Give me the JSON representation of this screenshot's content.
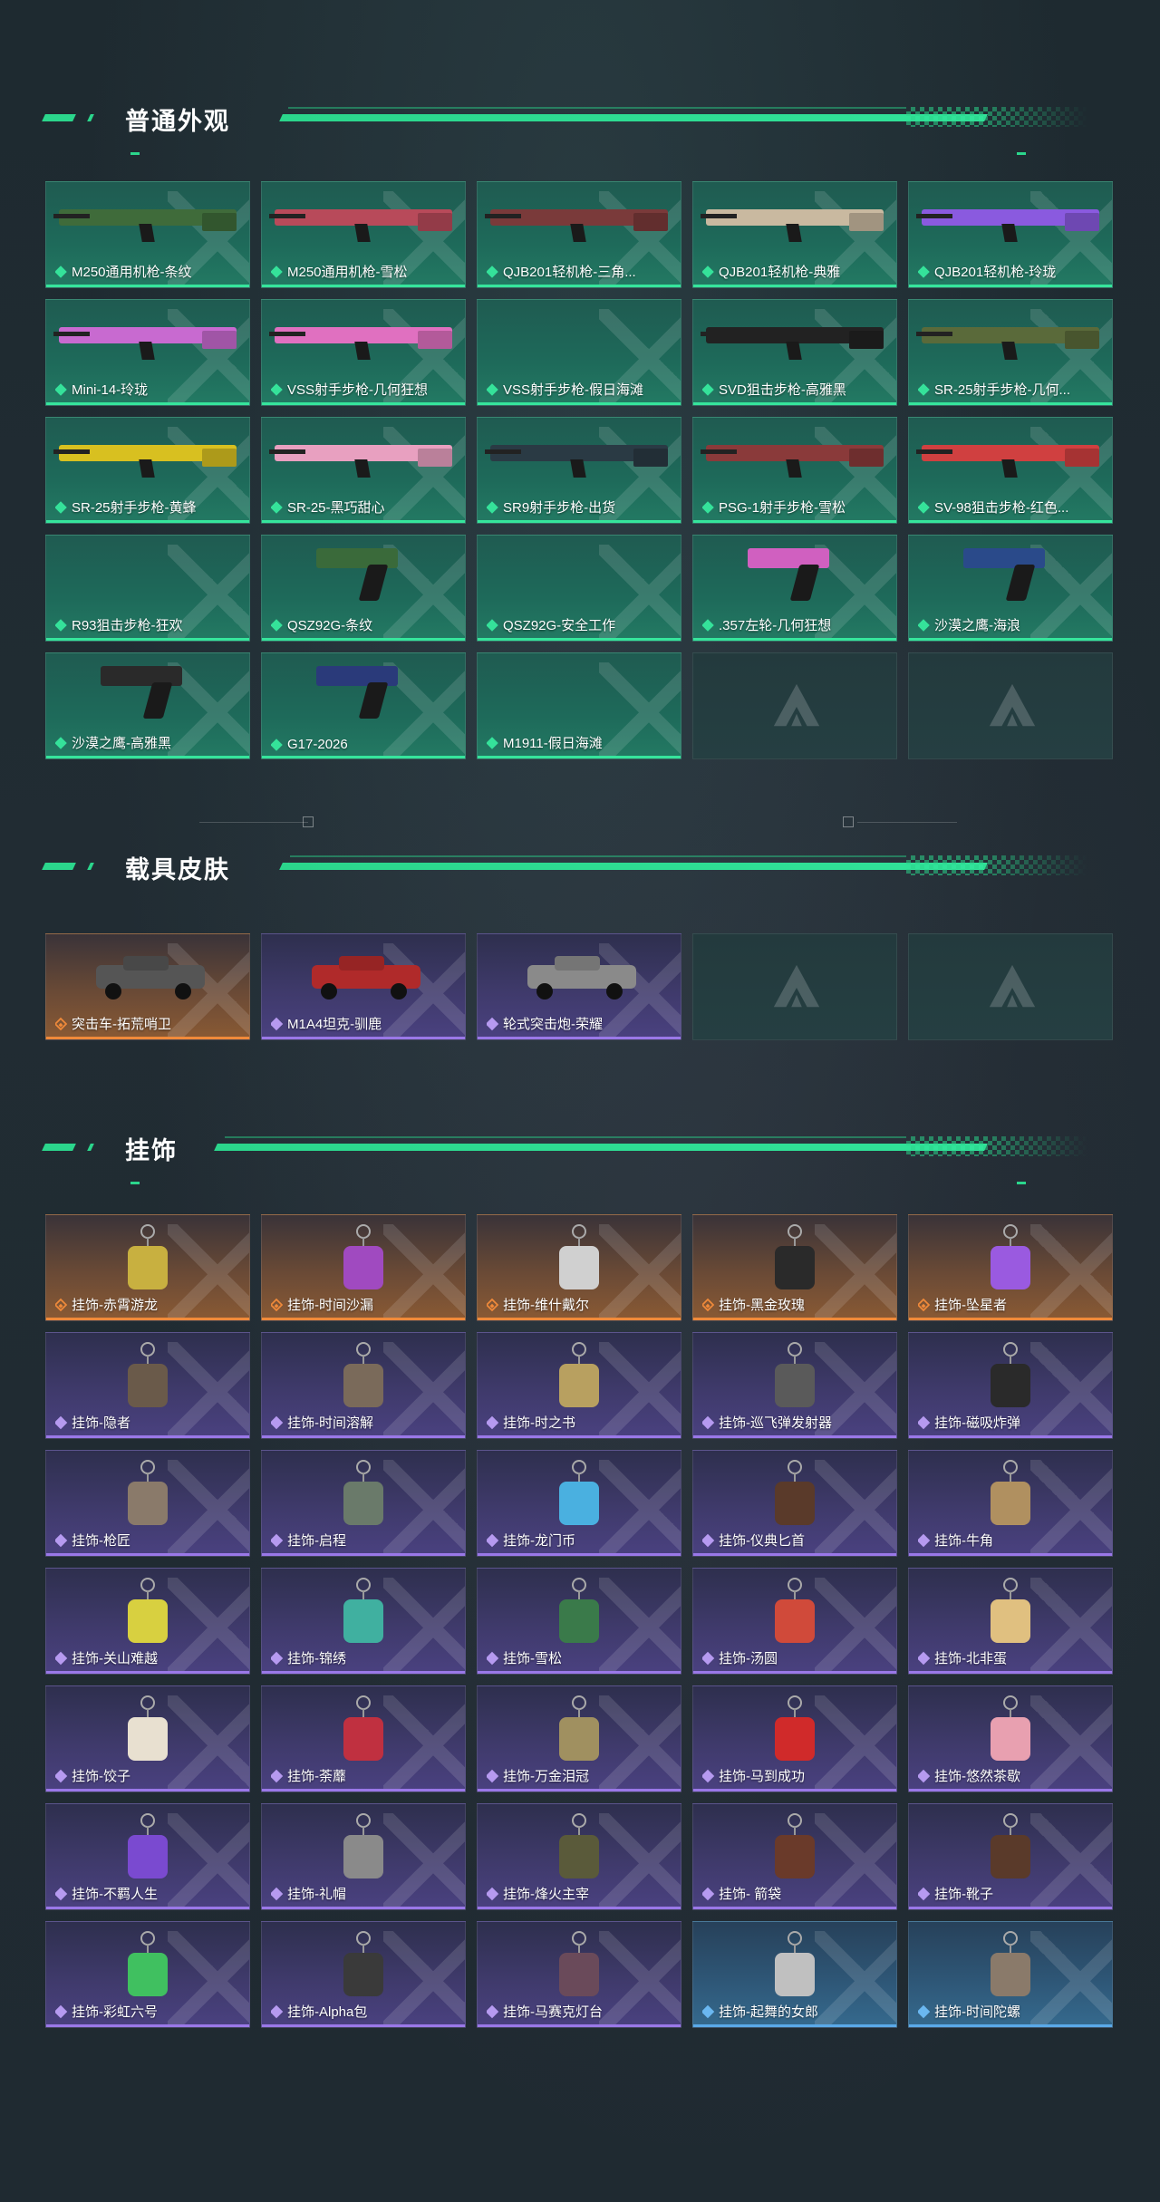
{
  "sections": {
    "weapons": {
      "title": "普通外观"
    },
    "vehicles": {
      "title": "载具皮肤"
    },
    "charms": {
      "title": "挂饰"
    }
  },
  "weapons": [
    {
      "label": "M250通用机枪-条纹",
      "rarity": "green",
      "color": "#3f6b3a"
    },
    {
      "label": "M250通用机枪-雪松",
      "rarity": "green",
      "color": "#b84a5a"
    },
    {
      "label": "QJB201轻机枪-三角...",
      "rarity": "green",
      "color": "#7a3a3a"
    },
    {
      "label": "QJB201轻机枪-典雅",
      "rarity": "green",
      "color": "#c9b9a0"
    },
    {
      "label": "QJB201轻机枪-玲珑",
      "rarity": "green",
      "color": "#8a5adf"
    },
    {
      "label": "Mini-14-玲珑",
      "rarity": "green",
      "color": "#c86ad0"
    },
    {
      "label": "VSS射手步枪-几何狂想",
      "rarity": "green",
      "color": "#e070c0"
    },
    {
      "label": "VSS射手步枪-假日海滩",
      "rarity": "green",
      "color": ""
    },
    {
      "label": "SVD狙击步枪-高雅黑",
      "rarity": "green",
      "color": "#222222"
    },
    {
      "label": "SR-25射手步枪-几何...",
      "rarity": "green",
      "color": "#5a6a3a"
    },
    {
      "label": "SR-25射手步枪-黄蜂",
      "rarity": "green",
      "color": "#d8c020"
    },
    {
      "label": "SR-25-黑巧甜心",
      "rarity": "green",
      "color": "#e8a0c0"
    },
    {
      "label": "SR9射手步枪-出货",
      "rarity": "green",
      "color": "#2a3a44"
    },
    {
      "label": "PSG-1射手步枪-雪松",
      "rarity": "green",
      "color": "#8a3a3a"
    },
    {
      "label": "SV-98狙击步枪-红色...",
      "rarity": "green",
      "color": "#d04040"
    },
    {
      "label": "R93狙击步枪-狂欢",
      "rarity": "green",
      "color": ""
    },
    {
      "label": "QSZ92G-条纹",
      "rarity": "green",
      "color": "#3a6a3a"
    },
    {
      "label": "QSZ92G-安全工作",
      "rarity": "green",
      "color": ""
    },
    {
      "label": ".357左轮-几何狂想",
      "rarity": "green",
      "color": "#d060c0"
    },
    {
      "label": "沙漠之鹰-海浪",
      "rarity": "green",
      "color": "#2a4a8a"
    },
    {
      "label": "沙漠之鹰-高雅黑",
      "rarity": "green",
      "color": "#2a2a2a"
    },
    {
      "label": "G17-2026",
      "rarity": "green",
      "color": "#2a3a7a"
    },
    {
      "label": "M1911-假日海滩",
      "rarity": "green",
      "color": ""
    },
    {
      "label": "",
      "rarity": "empty",
      "color": ""
    },
    {
      "label": "",
      "rarity": "empty",
      "color": ""
    }
  ],
  "vehicles": [
    {
      "label": "突击车-拓荒哨卫",
      "rarity": "orange",
      "color": "#555555"
    },
    {
      "label": "M1A4坦克-驯鹿",
      "rarity": "purple",
      "color": "#b02a2a"
    },
    {
      "label": "轮式突击炮-荣耀",
      "rarity": "purple",
      "color": "#8a8a8a"
    },
    {
      "label": "",
      "rarity": "empty",
      "color": ""
    },
    {
      "label": "",
      "rarity": "empty",
      "color": ""
    }
  ],
  "charms": [
    {
      "label": "挂饰-赤霄游龙",
      "rarity": "orange",
      "color": "#c8b040"
    },
    {
      "label": "挂饰-时间沙漏",
      "rarity": "orange",
      "color": "#a04ac0"
    },
    {
      "label": "挂饰-维什戴尔",
      "rarity": "orange",
      "color": "#d0d0d0"
    },
    {
      "label": "挂饰-黑金玫瑰",
      "rarity": "orange",
      "color": "#2a2a2a"
    },
    {
      "label": "挂饰-坠星者",
      "rarity": "orange",
      "color": "#9a5ae0"
    },
    {
      "label": "挂饰-隐者",
      "rarity": "purple",
      "color": "#6a5a4a"
    },
    {
      "label": "挂饰-时间溶解",
      "rarity": "purple",
      "color": "#7a6a5a"
    },
    {
      "label": "挂饰-时之书",
      "rarity": "purple",
      "color": "#b8a060"
    },
    {
      "label": "挂饰-巡飞弹发射器",
      "rarity": "purple",
      "color": "#5a5a5a"
    },
    {
      "label": "挂饰-磁吸炸弹",
      "rarity": "purple",
      "color": "#2a2a2a"
    },
    {
      "label": "挂饰-枪匠",
      "rarity": "purple",
      "color": "#8a7a6a"
    },
    {
      "label": "挂饰-启程",
      "rarity": "purple",
      "color": "#6a7a6a"
    },
    {
      "label": "挂饰-龙门币",
      "rarity": "purple",
      "color": "#4ab0e0"
    },
    {
      "label": "挂饰-仪典匕首",
      "rarity": "purple",
      "color": "#5a3a2a"
    },
    {
      "label": "挂饰-牛角",
      "rarity": "purple",
      "color": "#b09060"
    },
    {
      "label": "挂饰-关山难越",
      "rarity": "purple",
      "color": "#d8d040"
    },
    {
      "label": "挂饰-锦绣",
      "rarity": "purple",
      "color": "#40b0a0"
    },
    {
      "label": "挂饰-雪松",
      "rarity": "purple",
      "color": "#3a7a4a"
    },
    {
      "label": "挂饰-汤圆",
      "rarity": "purple",
      "color": "#d04a3a"
    },
    {
      "label": "挂饰-北非蛋",
      "rarity": "purple",
      "color": "#e0c080"
    },
    {
      "label": "挂饰-饺子",
      "rarity": "purple",
      "color": "#e8e0d0"
    },
    {
      "label": "挂饰-荼蘼",
      "rarity": "purple",
      "color": "#c03040"
    },
    {
      "label": "挂饰-万金泪冠",
      "rarity": "purple",
      "color": "#a09060"
    },
    {
      "label": "挂饰-马到成功",
      "rarity": "purple",
      "color": "#d02a2a"
    },
    {
      "label": "挂饰-悠然茶歇",
      "rarity": "purple",
      "color": "#e8a0b0"
    },
    {
      "label": "挂饰-不羁人生",
      "rarity": "purple",
      "color": "#7a4ad0"
    },
    {
      "label": "挂饰-礼帽",
      "rarity": "purple",
      "color": "#8a8a8a"
    },
    {
      "label": "挂饰-烽火主宰",
      "rarity": "purple",
      "color": "#5a5a3a"
    },
    {
      "label": "挂饰- 箭袋",
      "rarity": "purple",
      "color": "#6a3a2a"
    },
    {
      "label": "挂饰-靴子",
      "rarity": "purple",
      "color": "#5a3a2a"
    },
    {
      "label": "挂饰-彩虹六号",
      "rarity": "purple",
      "color": "#40c060"
    },
    {
      "label": "挂饰-Alpha包",
      "rarity": "purple",
      "color": "#3a3a3a"
    },
    {
      "label": "挂饰-马赛克灯台",
      "rarity": "purple",
      "color": "#6a4a5a"
    },
    {
      "label": "挂饰-起舞的女郎",
      "rarity": "blue",
      "color": "#c0c0c0"
    },
    {
      "label": "挂饰-时间陀螺",
      "rarity": "blue",
      "color": "#8a7a6a"
    }
  ]
}
